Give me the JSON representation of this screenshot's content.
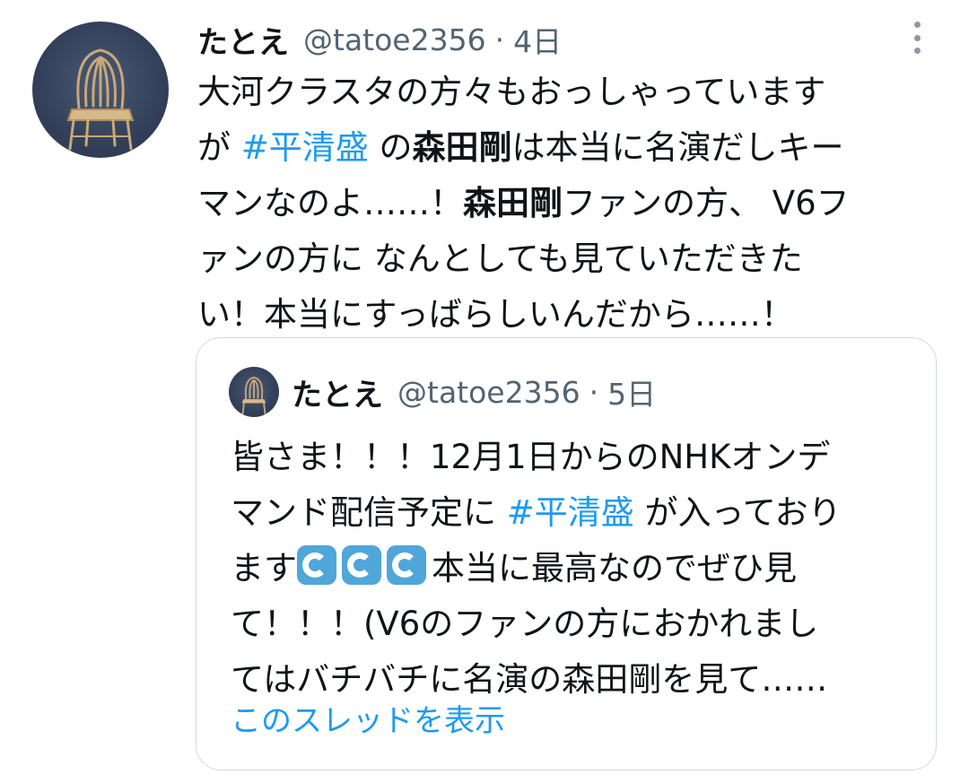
{
  "tweet": {
    "author_name": "たとえ",
    "author_handle": "@tatoe2356",
    "separator": "·",
    "time": "4日",
    "more_icon": "more-vertical-icon",
    "avatar_icon": "chair-avatar",
    "text": {
      "l1": "大河クラスタの方々もおっしゃっています",
      "l2_a": "が ",
      "l2_hashtag": "#平清盛",
      "l2_b": " の",
      "l2_bold": "森田剛",
      "l2_c": "は本当に名演だしキー",
      "l3_a": "マンなのよ……！",
      "l3_bold": "森田剛",
      "l3_b": "ファンの方、 V6フ",
      "l4": "ァンの方に なんとしても見ていただきた",
      "l5": "い！本当にすっばらしいんだから……！"
    },
    "colors": {
      "link": "#1d9bf0",
      "text": "#0f1419",
      "secondary": "#536471",
      "border": "#cfd9de"
    }
  },
  "quoted_tweet": {
    "author_name": "たとえ",
    "author_handle": "@tatoe2356",
    "separator": "·",
    "time": "5日",
    "text": {
      "l1": "皆さま！！！12月1日からのNHKオンデ",
      "l2_a": "マンド配信予定に ",
      "l2_hashtag": "#平清盛",
      "l2_b": " が入っており",
      "l3_a": "ます",
      "emoji": "🌊",
      "emoji_icon": "water-wave-emoji",
      "l3_b": "本当に最高なのでぜひ見",
      "l4": "て！！！(V6のファンの方におかれまし",
      "l5": "てはバチバチに名演の森田剛を見て……"
    },
    "show_thread": "このスレッドを表示"
  }
}
